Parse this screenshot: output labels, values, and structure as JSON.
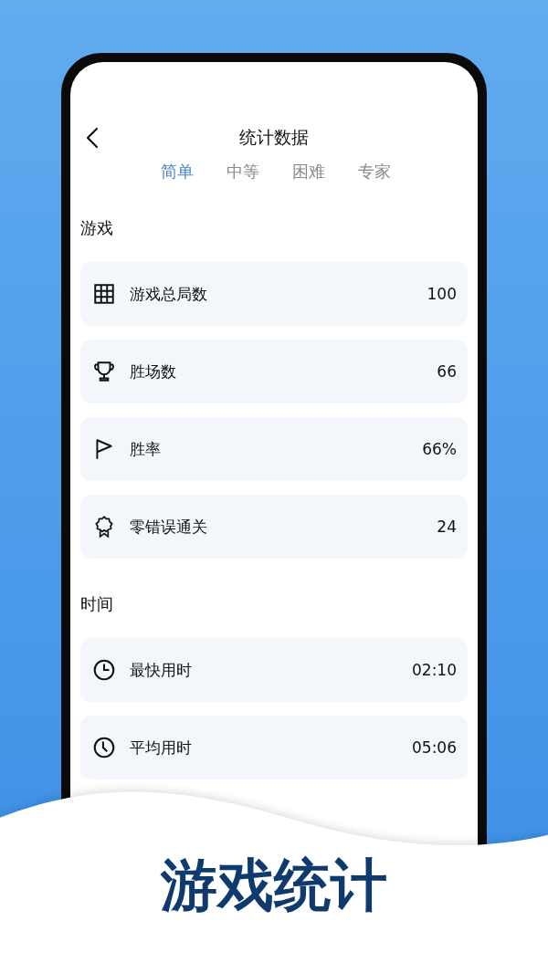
{
  "header": {
    "title": "统计数据"
  },
  "tabs": [
    {
      "label": "简单",
      "selected": true
    },
    {
      "label": "中等",
      "selected": false
    },
    {
      "label": "困难",
      "selected": false
    },
    {
      "label": "专家",
      "selected": false
    }
  ],
  "sections": [
    {
      "title": "游戏",
      "rows": [
        {
          "label": "游戏总局数",
          "value": "100"
        },
        {
          "label": "胜场数",
          "value": "66"
        },
        {
          "label": "胜率",
          "value": "66%"
        },
        {
          "label": "零错误通关",
          "value": "24"
        }
      ]
    },
    {
      "title": "时间",
      "rows": [
        {
          "label": "最快用时",
          "value": "02:10"
        },
        {
          "label": "平均用时",
          "value": "05:06"
        }
      ]
    }
  ],
  "caption": "游戏统计"
}
